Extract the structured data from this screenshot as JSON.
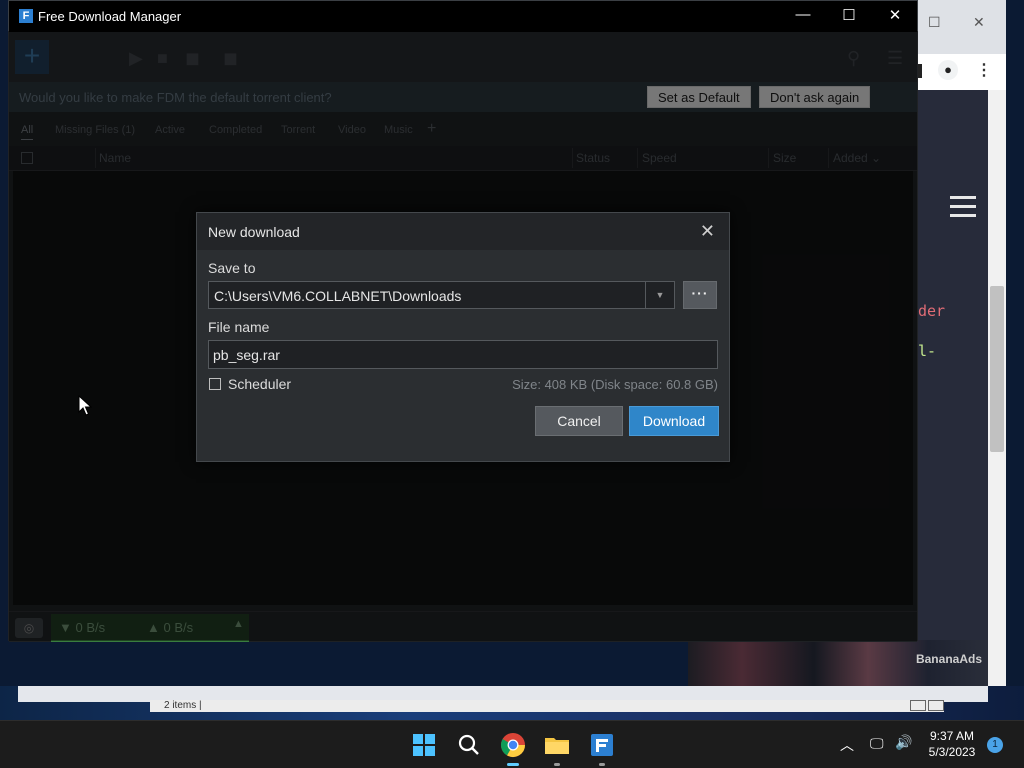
{
  "window": {
    "title": "Free Download Manager",
    "minimize_label": "—",
    "maximize_label": "☐",
    "close_label": "✕"
  },
  "banner": {
    "message": "Would you like to make FDM the default torrent client?",
    "set_default_label": "Set as Default",
    "dont_ask_label": "Don't ask again"
  },
  "tabs": [
    {
      "label": "All"
    },
    {
      "label": "Missing Files (1)"
    },
    {
      "label": "Active"
    },
    {
      "label": "Completed"
    },
    {
      "label": "Torrent"
    },
    {
      "label": "Video"
    },
    {
      "label": "Music"
    },
    {
      "label": "+"
    }
  ],
  "columns": {
    "name": "Name",
    "status": "Status",
    "speed": "Speed",
    "size": "Size",
    "added": "Added ⌄"
  },
  "statusbar": {
    "download_speed": "▼ 0 B/s",
    "upload_speed": "▲ 0 B/s"
  },
  "dialog": {
    "title": "New download",
    "save_to_label": "Save to",
    "save_to_value": "C:\\Users\\VM6.COLLABNET\\Downloads",
    "browse_label": "···",
    "file_name_label": "File name",
    "file_name_value": "pb_seg.rar",
    "scheduler_label": "Scheduler",
    "scheduler_checked": false,
    "size_info": "Size: 408 KB (Disk space: 60.8 GB)",
    "cancel_label": "Cancel",
    "download_label": "Download"
  },
  "background": {
    "explorer_status": "2 items  |",
    "code_line_1": "der",
    "code_line_2": "l-",
    "thumbnail_label": "BananaAds"
  },
  "taskbar": {
    "time": "9:37 AM",
    "date": "5/3/2023",
    "notification_count": "1"
  },
  "colors": {
    "accent": "#2f86c9",
    "dialog_bg": "#2b2e31",
    "window_bg": "#1e2124"
  }
}
